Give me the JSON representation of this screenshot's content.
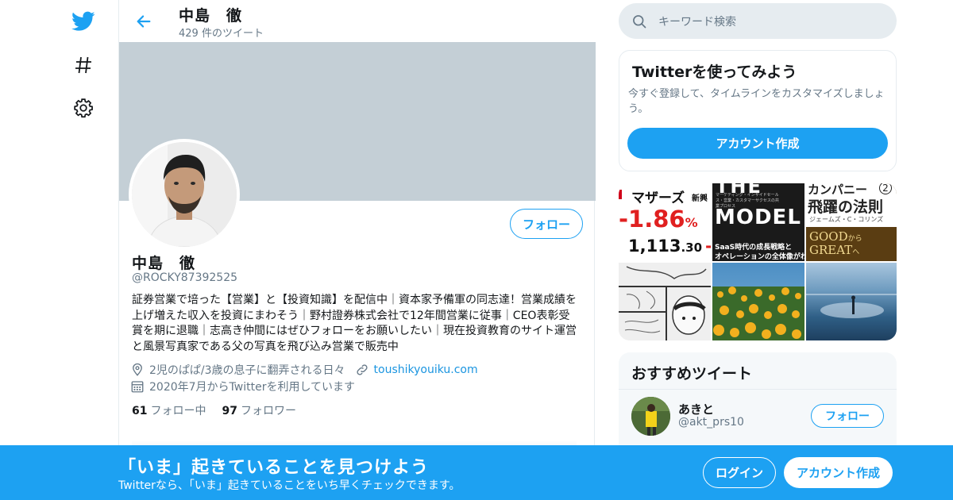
{
  "nav": {
    "icons": [
      "twitter-bird-icon",
      "hashtag-icon",
      "gear-icon"
    ]
  },
  "header": {
    "title": "中島　徹",
    "tweet_count": "429 件のツイート"
  },
  "profile": {
    "follow_label": "フォロー",
    "name": "中島　徹",
    "handle": "@ROCKY87392525",
    "bio": "証券営業で培った【営業】と【投資知識】を配信中｜資本家予備軍の同志達！営業成績を上げ増えた収入を投資にまわそう｜野村證券株式会社で12年間営業に従事｜CEO表彰受賞を期に退職｜志高き仲間にはぜひフォローをお願いしたい｜現在投資教育のサイト運営と風景写真家である父の写真を飛び込み営業で販売中",
    "location": "2児のぱぱ/3歳の息子に翻弄される日々",
    "url": "toushikyouiku.com",
    "joined": "2020年7月からTwitterを利用しています",
    "following_count": "61",
    "following_label": "フォロー中",
    "followers_count": "97",
    "followers_label": "フォロワー"
  },
  "search": {
    "placeholder": "キーワード検索"
  },
  "signup_card": {
    "title": "Twitterを使ってみよう",
    "text": "今すぐ登録して、タイムラインをカスタマイズしましょう。",
    "button": "アカウント作成"
  },
  "media": {
    "tile1": {
      "line1": "マザーズ",
      "line1b": "新興",
      "line2": "-1.86",
      "line2b": "%",
      "line3": "1,113",
      "line3b": ".30",
      "line3c": "-"
    },
    "tile2": {
      "top": "THE",
      "sub": "マーケティング・インサイドセールス・営業・カスタマーサクセスの共業プロセス",
      "big": "MODEL",
      "bottom1": "SaaS時代の成長戦略と",
      "bottom2": "オペレーションの全体像がわかる"
    },
    "tile3": {
      "top": "カンパニー",
      "num": "2",
      "title": "飛躍の法則",
      "author": "ジェームズ・C・コリンズ",
      "big1": "GOOD",
      "big1b": "から",
      "big2": "GREAT",
      "big2b": "へ"
    }
  },
  "recommend": {
    "title": "おすすめツイート",
    "user_name": "あきと",
    "user_handle": "@akt_prs10",
    "follow_label": "フォロー"
  },
  "bottom_bar": {
    "title": "「いま」起きていることを見つけよう",
    "subtitle": "Twitterなら、「いま」起きていることをいち早くチェックできます。",
    "login": "ログイン",
    "signup": "アカウント作成"
  },
  "colors": {
    "accent": "#1da1f2",
    "banner": "#c4cfd6",
    "secondary_text": "#657786"
  }
}
